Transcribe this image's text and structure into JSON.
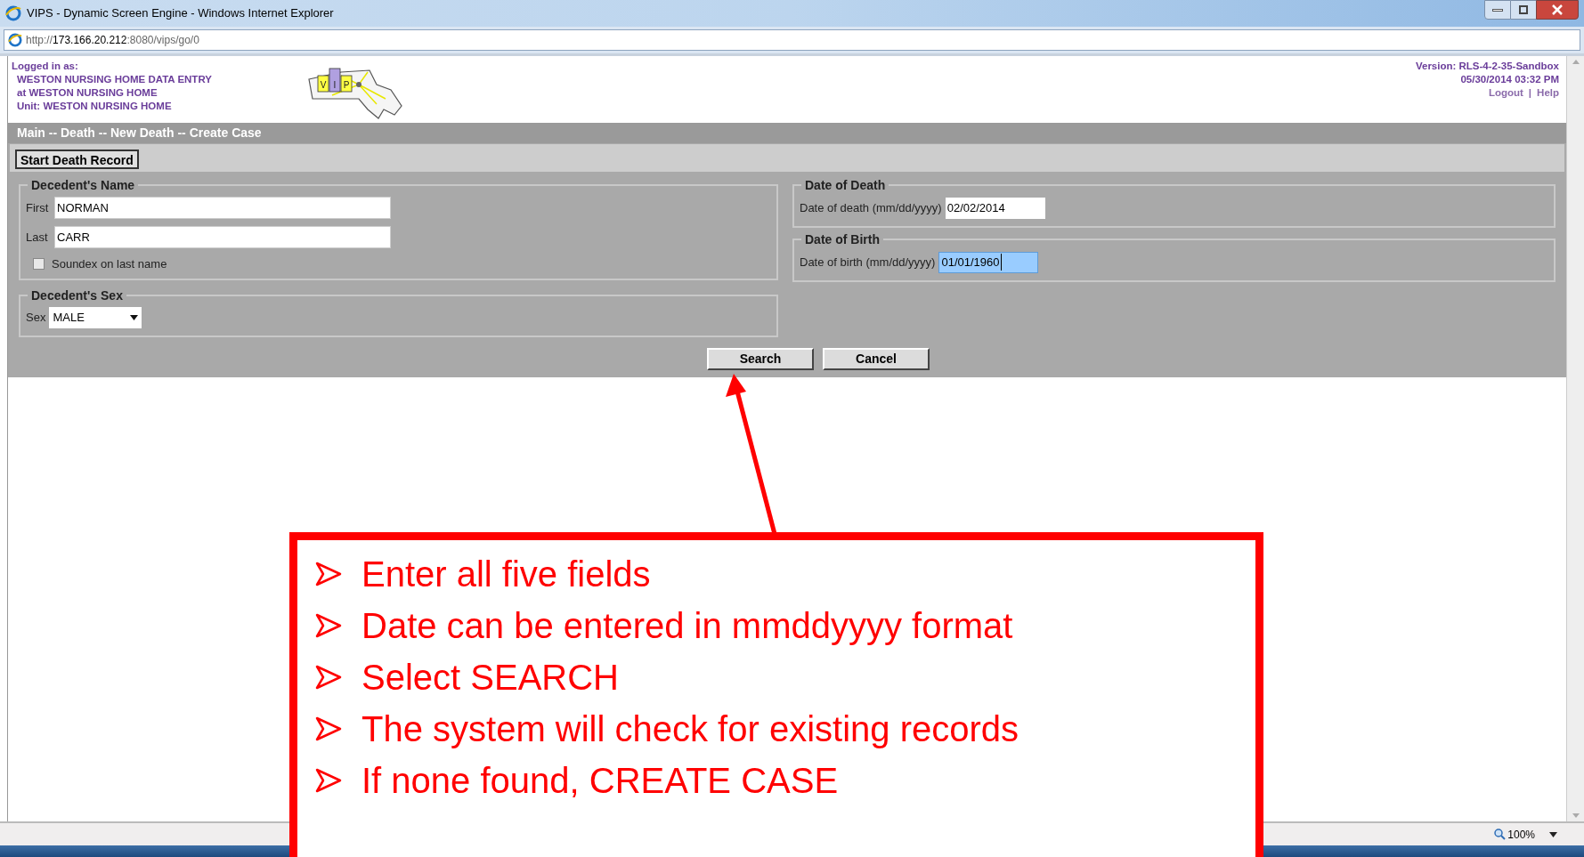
{
  "window": {
    "title": "VIPS - Dynamic Screen Engine - Windows Internet Explorer"
  },
  "address_bar": {
    "url_scheme": "http://",
    "url_host": "173.166.20.212",
    "url_rest": ":8080/vips/go/0"
  },
  "header": {
    "logged_in_label": "Logged in as:",
    "user_lines": [
      "WESTON NURSING HOME DATA ENTRY",
      "at WESTON NURSING HOME",
      "Unit: WESTON NURSING HOME"
    ],
    "logo_letters": [
      "V",
      "I",
      "P"
    ],
    "version": "Version: RLS-4-2-35-Sandbox",
    "datetime": "05/30/2014 03:32 PM",
    "links": [
      "Logout",
      "Help"
    ],
    "link_separator": "|"
  },
  "breadcrumb": "Main -- Death -- New Death -- Create Case",
  "tabs": [
    {
      "label": "Start Death Record",
      "selected": true
    }
  ],
  "name_group": {
    "legend": "Decedent's Name",
    "fields": [
      {
        "label": "First",
        "value": "NORMAN"
      },
      {
        "label": "Last",
        "value": "CARR"
      }
    ],
    "soundex": {
      "label": "Soundex on last name",
      "checked": false
    }
  },
  "sex_group": {
    "legend": "Decedent's Sex",
    "label": "Sex",
    "value": "MALE"
  },
  "date_groups": [
    {
      "legend": "Date of Death",
      "label": "Date of death (mm/dd/yyyy)",
      "value": "02/02/2014",
      "text_selected": false
    },
    {
      "legend": "Date of Birth",
      "label": "Date of birth (mm/dd/yyyy)",
      "value": "01/01/1960",
      "text_selected": true
    }
  ],
  "buttons": [
    "Search",
    "Cancel"
  ],
  "status_bar": {
    "zoom": "100%"
  },
  "callout": {
    "items": [
      "Enter all five fields",
      "Date can be entered in mmddyyyy format",
      "Select SEARCH",
      "The system will check for existing records",
      "If none found, CREATE CASE"
    ]
  }
}
